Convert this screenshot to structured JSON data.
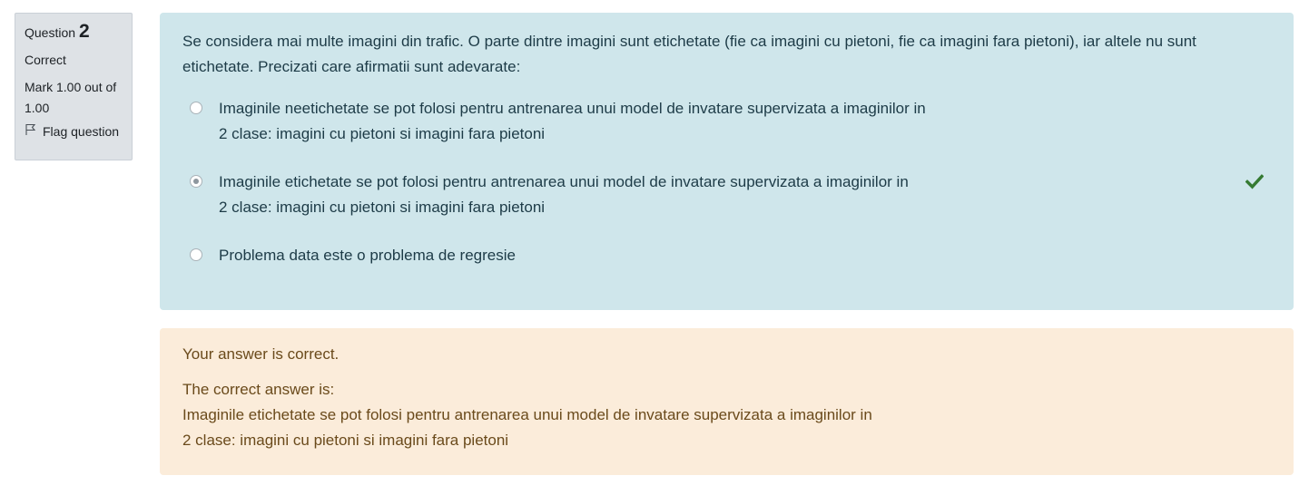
{
  "info": {
    "question_label": "Question",
    "question_number": "2",
    "state": "Correct",
    "grade": "Mark 1.00 out of 1.00",
    "flag_label": "Flag question"
  },
  "question": {
    "text": "Se considera mai multe imagini din trafic. O parte dintre imagini sunt etichetate (fie ca imagini cu pietoni, fie ca imagini fara pietoni), iar altele nu sunt etichetate. Precizati care afirmatii sunt adevarate:",
    "answers": [
      {
        "line1": "Imaginile neetichetate se pot folosi pentru antrenarea unui model de invatare supervizata a imaginilor in",
        "line2": "2 clase: imagini cu pietoni si imagini fara pietoni",
        "selected": false
      },
      {
        "line1": "Imaginile etichetate se pot folosi pentru antrenarea unui model de invatare supervizata a imaginilor in",
        "line2": "2 clase: imagini cu pietoni si imagini fara pietoni",
        "selected": true,
        "correct_icon": "check-icon"
      },
      {
        "line1": "Problema data este o problema de regresie",
        "line2": "",
        "selected": false
      }
    ]
  },
  "feedback": {
    "general": "Your answer is correct.",
    "right_answer_label": "The correct answer is:",
    "right_answer_line1": "Imaginile etichetate se pot folosi pentru antrenarea unui model de invatare supervizata a imaginilor in",
    "right_answer_line2": "2 clase: imagini cu pietoni si imagini fara pietoni"
  },
  "colors": {
    "info_bg": "#dee2e6",
    "formulation_bg": "#cfe6eb",
    "feedback_bg": "#fbecda",
    "correct_green": "#357a32"
  }
}
